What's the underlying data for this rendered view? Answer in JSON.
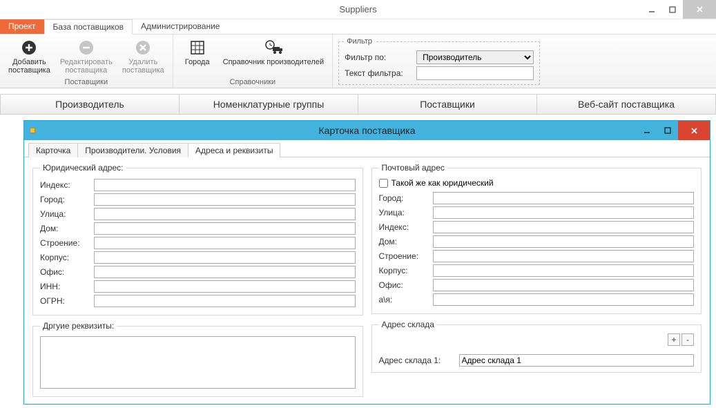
{
  "window": {
    "title": "Suppliers"
  },
  "ribbonTabs": {
    "accent": "Проект",
    "active": "База поставщиков",
    "other": "Администрирование"
  },
  "ribbon": {
    "suppliers": {
      "add": "Добавить\nпоставщика",
      "edit": "Редактировать\nпоставщика",
      "del": "Удалить\nпоставщика",
      "group": "Поставщики"
    },
    "refs": {
      "cities": "Города",
      "mfg": "Справочник производителей",
      "group": "Справочники"
    },
    "filter": {
      "legend": "Фильтр",
      "byLabel": "Фильтр по:",
      "bySelected": "Производитель",
      "textLabel": "Текст фильтра:",
      "textValue": ""
    }
  },
  "pageTabs": [
    "Производитель",
    "Номенклатурные группы",
    "Поставщики",
    "Веб-сайт поставщика"
  ],
  "modal": {
    "title": "Карточка поставщика",
    "tabs": [
      "Карточка",
      "Производители. Условия",
      "Адреса и реквизиты"
    ],
    "activeTab": 2,
    "legal": {
      "legend": "Юридический адрес:",
      "fields": {
        "index": "Индекс:",
        "city": "Город:",
        "street": "Улица:",
        "house": "Дом:",
        "building": "Строение:",
        "korpus": "Корпус:",
        "office": "Офис:",
        "inn": "ИНН:",
        "ogrn": "ОГРН:"
      }
    },
    "other": {
      "legend": "Дргуие реквизиты:"
    },
    "postal": {
      "legend": "Почтовый адрес",
      "same": "Такой же как юридический",
      "fields": {
        "city": "Город:",
        "street": "Улица:",
        "index": "Индекс:",
        "house": "Дом:",
        "building": "Строение:",
        "korpus": "Корпус:",
        "office": "Офис:",
        "pobox": "а\\я:"
      }
    },
    "warehouse": {
      "legend": "Адрес склада",
      "rowLabel": "Адрес склада 1:",
      "rowValue": "Адрес склада 1"
    }
  }
}
